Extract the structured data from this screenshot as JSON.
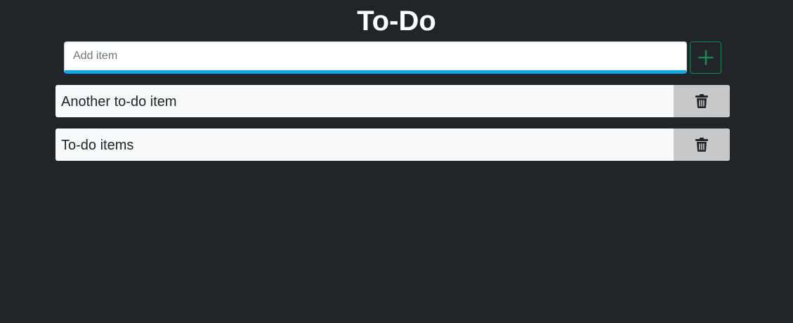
{
  "header": {
    "title": "To-Do"
  },
  "add_form": {
    "placeholder": "Add item",
    "value": "",
    "button_icon": "plus-icon",
    "accent_color": "#0ea5e9",
    "button_color": "#198754"
  },
  "todos": [
    {
      "text": "Another to-do item",
      "action_icon": "trash-icon"
    },
    {
      "text": "To-do items",
      "action_icon": "trash-icon"
    }
  ],
  "colors": {
    "background": "#212529",
    "item_background": "#f8f9fa",
    "delete_background": "#c7c8c9"
  }
}
